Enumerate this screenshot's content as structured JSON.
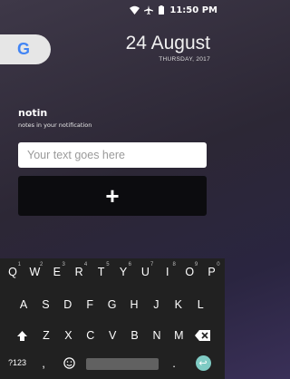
{
  "status_bar": {
    "time": "11:50",
    "ampm": "PM"
  },
  "google_widget": {
    "letter": "G"
  },
  "date_widget": {
    "date": "24 August",
    "weekday_year": "THURSDAY, 2017"
  },
  "app": {
    "title": "notin",
    "subtitle": "notes in your notification"
  },
  "input": {
    "placeholder": "Your text goes here",
    "value": ""
  },
  "add_button": {
    "symbol": "+"
  },
  "keyboard": {
    "row1": [
      {
        "label": "Q",
        "hint": "1"
      },
      {
        "label": "W",
        "hint": "2"
      },
      {
        "label": "E",
        "hint": "3"
      },
      {
        "label": "R",
        "hint": "4"
      },
      {
        "label": "T",
        "hint": "5"
      },
      {
        "label": "Y",
        "hint": "6"
      },
      {
        "label": "U",
        "hint": "7"
      },
      {
        "label": "I",
        "hint": "8"
      },
      {
        "label": "O",
        "hint": "9"
      },
      {
        "label": "P",
        "hint": "0"
      }
    ],
    "row2": [
      "A",
      "S",
      "D",
      "F",
      "G",
      "H",
      "J",
      "K",
      "L"
    ],
    "row3": [
      "Z",
      "X",
      "C",
      "V",
      "B",
      "N",
      "M"
    ],
    "symbols_label": "?123",
    "comma": ",",
    "period": ".",
    "accent_color": "#7fcbc4"
  }
}
